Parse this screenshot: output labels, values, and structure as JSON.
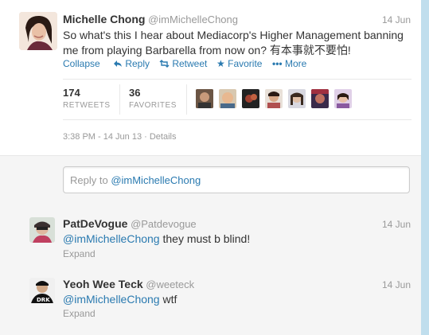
{
  "tweet": {
    "fullname": "Michelle Chong",
    "username": "@imMichelleChong",
    "date": "14 Jun",
    "text_line1": "So what's this I hear about Mediacorp's Higher Management banning",
    "text_line2": "me from playing Barbarella from now on? 有本事就不要怕!",
    "actions": {
      "collapse": "Collapse",
      "reply": "Reply",
      "retweet": "Retweet",
      "favorite": "Favorite",
      "more": "More"
    },
    "stats": {
      "retweets_count": "174",
      "retweets_label": "RETWEETS",
      "favorites_count": "36",
      "favorites_label": "FAVORITES"
    },
    "timestamp": "3:38 PM - 14 Jun 13",
    "details": "Details"
  },
  "reply_input": {
    "placeholder_prefix": "Reply to ",
    "placeholder_mention": "@imMichelleChong"
  },
  "replies": [
    {
      "fullname": "PatDeVogue",
      "username": "@Patdevogue",
      "date": "14 Jun",
      "mention": "@imMichelleChong",
      "text": " they must b blind!",
      "expand": "Expand"
    },
    {
      "fullname": "Yeoh Wee Teck",
      "username": "@weeteck",
      "date": "14 Jun",
      "mention": "@imMichelleChong",
      "text": " wtf",
      "expand": "Expand"
    }
  ],
  "colors": {
    "link": "#2a7ab0",
    "muted": "#999999",
    "background": "#c0deed"
  },
  "icons": {
    "reply": "reply-arrow-icon",
    "retweet": "retweet-arrows-icon",
    "favorite": "star-icon",
    "more": "dots-icon"
  }
}
